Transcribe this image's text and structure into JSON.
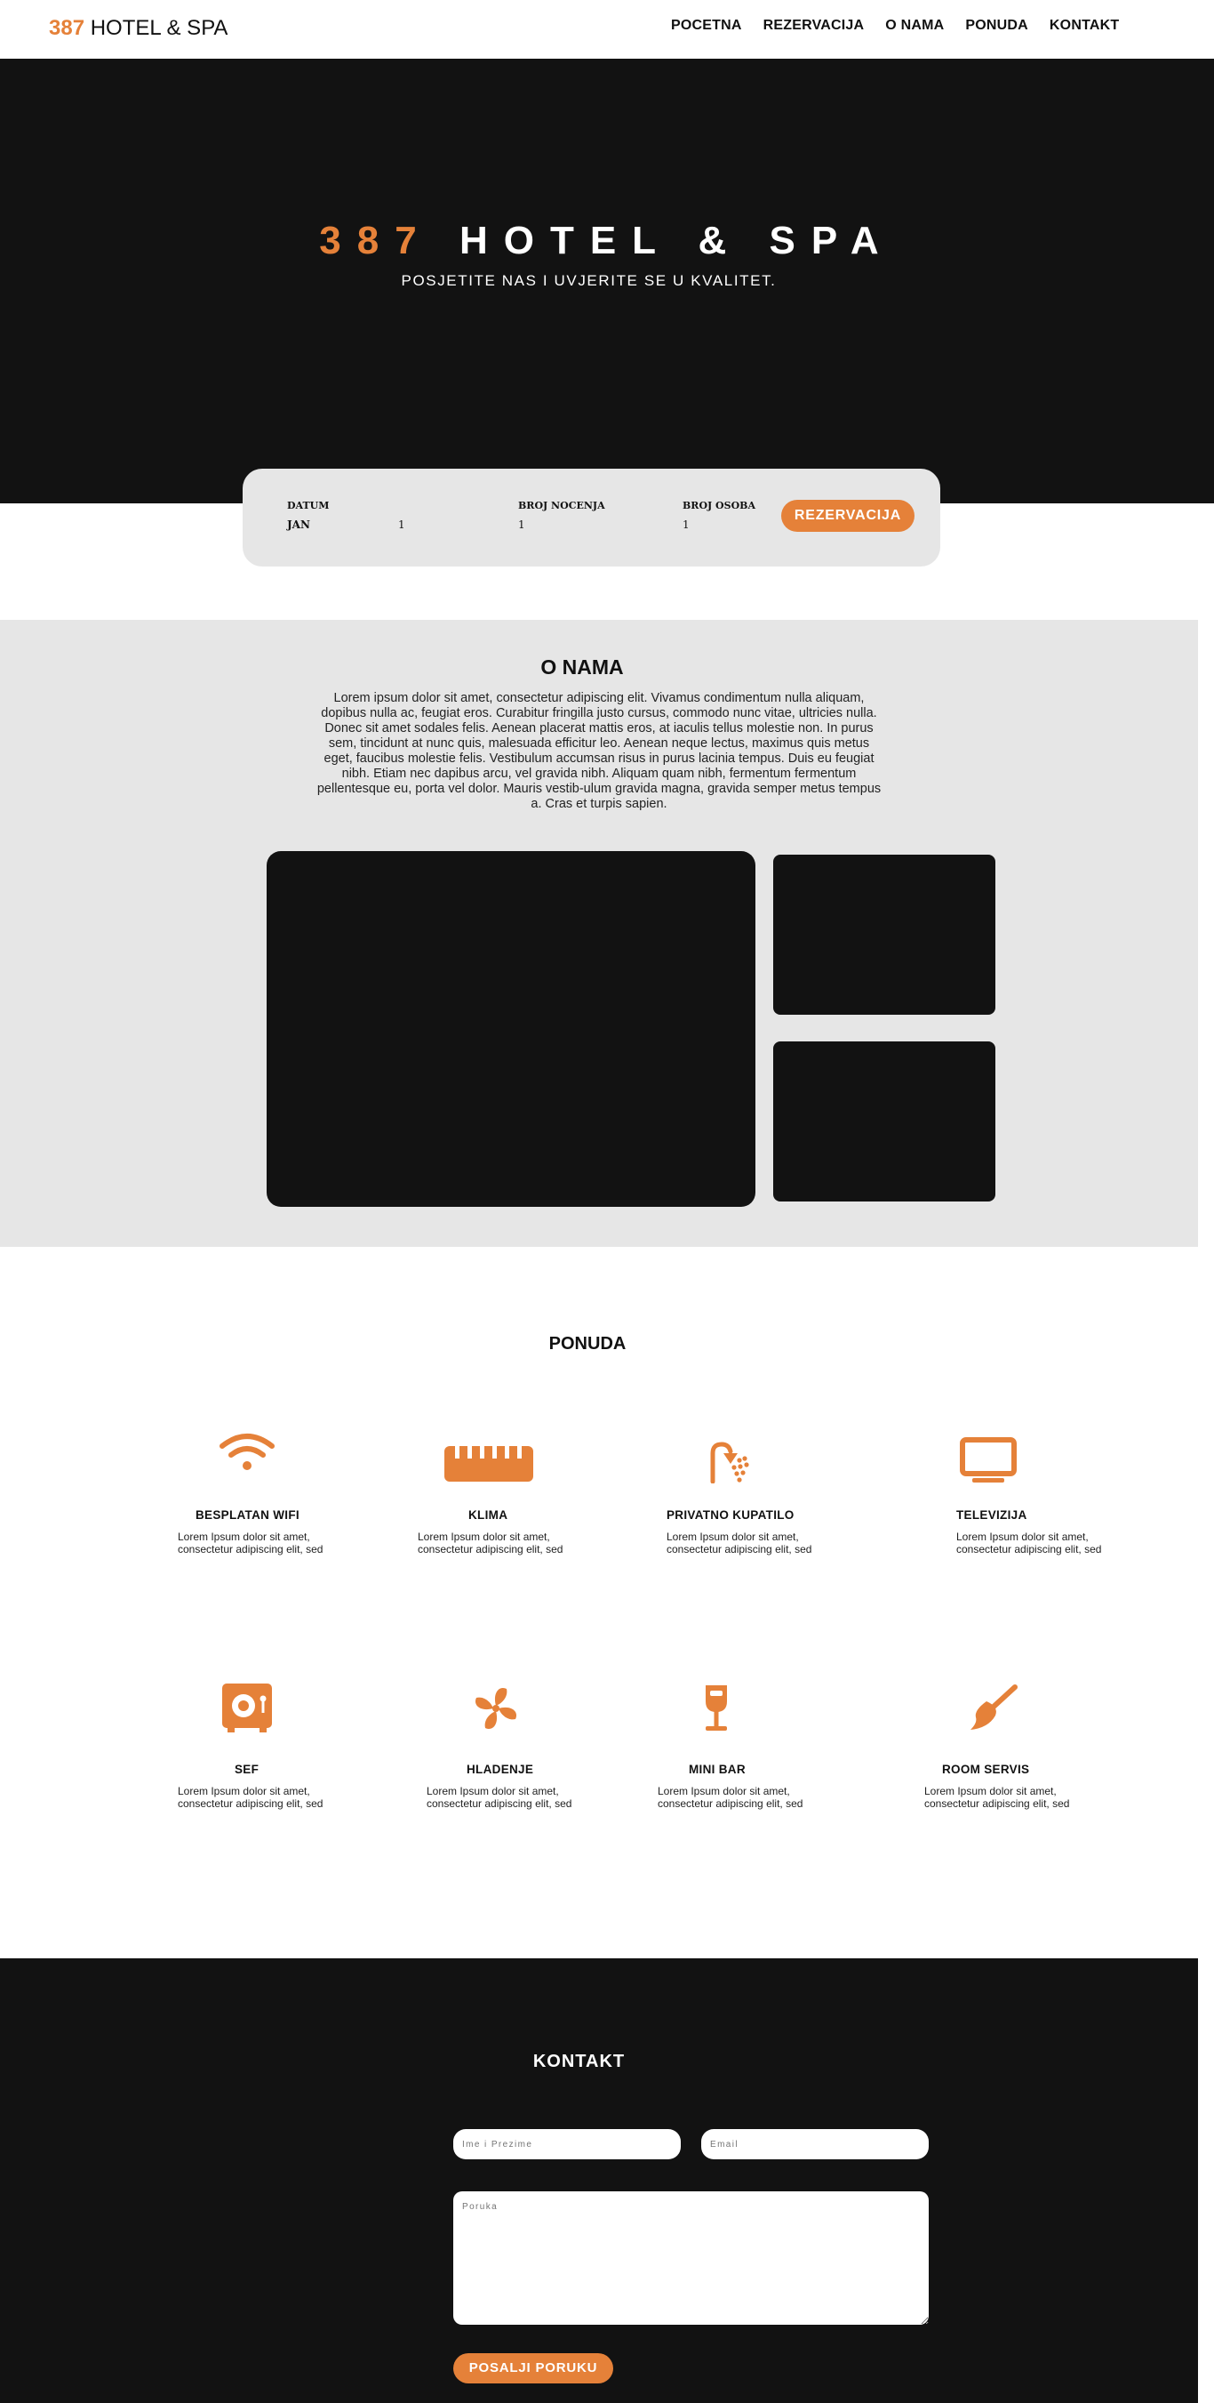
{
  "navbar": {
    "brand_number": "387",
    "brand_name": " HOTEL & SPA",
    "links": [
      "POCETNA",
      "REZERVACIJA",
      "O NAMA",
      "PONUDA",
      "KONTAKT"
    ]
  },
  "hero": {
    "title_number": "387",
    "title_name": " HOTEL & SPA",
    "subtitle": "POSJETITE NAS I UVJERITE SE U KVALITET."
  },
  "booking": {
    "date_label": "DATUM",
    "date_month": "JAN",
    "date_day": "1",
    "nights_label": "BROJ NOCENJA",
    "nights_value": "1",
    "persons_label": "BROJ OSOBA",
    "persons_value": "1",
    "button_label": "REZERVACIJA"
  },
  "about": {
    "title": "O NAMA",
    "text": "Lorem ipsum dolor sit amet, consectetur adipiscing elit. Vivamus condimentum nulla aliquam, dopibus nulla ac, feugiat eros. Curabitur fringilla justo cursus, commodo nunc vitae, ultricies nulla. Donec sit amet sodales felis. Aenean placerat mattis eros, at iaculis tellus molestie non. In purus sem, tincidunt at nunc quis, malesuada efficitur leo. Aenean neque lectus, maximus quis metus eget, faucibus molestie felis. Vestibulum accumsan risus in purus lacinia tempus. Duis eu feugiat nibh. Etiam nec dapibus arcu, vel gravida nibh. Aliquam quam nibh, fermentum fermentum pellentesque eu, porta vel dolor. Mauris vestib-ulum gravida magna, gravida semper metus tempus a. Cras et turpis sapien."
  },
  "ponuda": {
    "title": "PONUDA",
    "features": [
      {
        "icon": "wifi-icon",
        "title": "BESPLATAN WIFI",
        "text": "Lorem Ipsum dolor sit amet, consectetur adipiscing elit, sed"
      },
      {
        "icon": "air-conditioner-icon",
        "title": "KLIMA",
        "text": "Lorem Ipsum dolor sit amet, consectetur adipiscing elit, sed"
      },
      {
        "icon": "shower-icon",
        "title": "PRIVATNO KUPATILO",
        "text": "Lorem Ipsum dolor sit amet, consectetur adipiscing elit, sed"
      },
      {
        "icon": "tv-icon",
        "title": "TELEVIZIJA",
        "text": "Lorem Ipsum dolor sit amet, consectetur adipiscing elit, sed"
      },
      {
        "icon": "safe-icon",
        "title": "SEF",
        "text": "Lorem Ipsum dolor sit amet, consectetur adipiscing elit, sed"
      },
      {
        "icon": "fan-icon",
        "title": "HLADENJE",
        "text": "Lorem Ipsum dolor sit amet, consectetur adipiscing elit, sed"
      },
      {
        "icon": "wine-glass-icon",
        "title": "MINI BAR",
        "text": "Lorem Ipsum dolor sit amet, consectetur adipiscing elit, sed"
      },
      {
        "icon": "broom-icon",
        "title": "ROOM SERVIS",
        "text": "Lorem Ipsum dolor sit amet, consectetur adipiscing elit, sed"
      }
    ]
  },
  "kontakt": {
    "title": "KONTAKT",
    "name_placeholder": "Ime i Prezime",
    "email_placeholder": "Email",
    "message_placeholder": "Poruka",
    "send_label": "POSALJI PORUKU"
  },
  "colors": {
    "accent": "#e58139",
    "dark": "#121212",
    "light_gray": "#e6e6e6"
  }
}
